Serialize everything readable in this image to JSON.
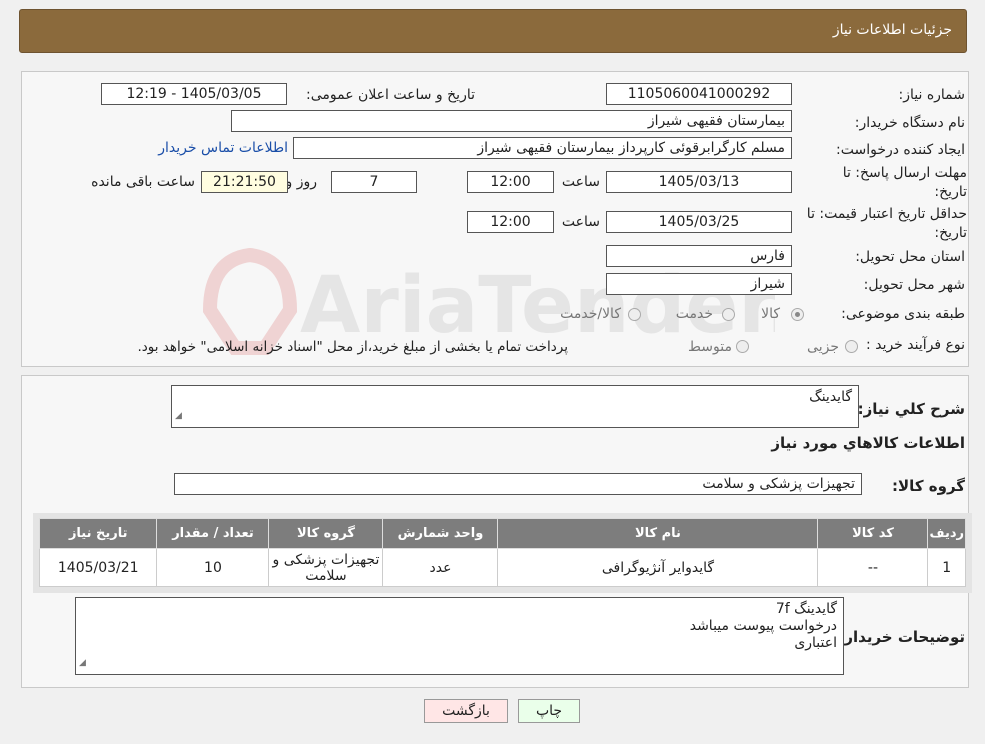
{
  "header": {
    "title": "جزئیات اطلاعات نیاز"
  },
  "form": {
    "need_number_label": "شماره نیاز:",
    "need_number": "1105060041000292",
    "announce_label": "تاریخ و ساعت اعلان عمومی:",
    "announce_value": "1405/03/05 - 12:19",
    "buyer_org_label": "نام دستگاه خریدار:",
    "buyer_org": "بیمارستان فقیهی شیراز",
    "creator_label": "ایجاد کننده درخواست:",
    "creator": "مسلم کارگرابرقوئی کارپرداز  بیمارستان فقیهی شیراز",
    "contact_link": "اطلاعات تماس خریدار",
    "deadline_label": "مهلت ارسال پاسخ: تا تاریخ:",
    "deadline_date": "1405/03/13",
    "time_label": "ساعت",
    "deadline_time": "12:00",
    "days_value": "7",
    "days_label": "روز و",
    "remaining_time": "21:21:50",
    "remaining_label": "ساعت باقی مانده",
    "validity_label": "حداقل تاریخ اعتبار قیمت: تا تاریخ:",
    "validity_date": "1405/03/25",
    "validity_time": "12:00",
    "province_label": "استان محل تحویل:",
    "province": "فارس",
    "city_label": "شهر محل تحویل:",
    "city": "شیراز",
    "category_label": "طبقه بندی موضوعی:",
    "category_options": [
      "کالا",
      "خدمت",
      "کالا/خدمت"
    ],
    "process_label": "نوع فرآیند خرید :",
    "process_options": [
      "جزیی",
      "متوسط"
    ],
    "process_note": "پرداخت تمام یا بخشی از مبلغ خرید،از محل \"اسناد خزانه اسلامی\" خواهد بود."
  },
  "summary": {
    "desc_label": "شرح کلي نياز:",
    "desc_value": "گایدینگ",
    "goods_info_title": "اطلاعات کالاهاي مورد نياز",
    "group_label": "گروه کالا:",
    "group_value": "تجهیزات پزشکی و سلامت"
  },
  "table": {
    "headers": [
      "رديف",
      "کد کالا",
      "نام کالا",
      "واحد شمارش",
      "گروه کالا",
      "تعداد / مقدار",
      "تاريخ نياز"
    ],
    "rows": [
      [
        "1",
        "--",
        "گایدوایر آنژیوگرافی",
        "عدد",
        "تجهیزات پزشکی و سلامت",
        "10",
        "1405/03/21"
      ]
    ]
  },
  "buyer_notes": {
    "label": "توضیحات خریدار:",
    "lines": [
      "گایدینگ 7f",
      "درخواست پیوست میباشد",
      "اعتباری"
    ]
  },
  "buttons": {
    "print": "چاپ",
    "back": "بازگشت"
  },
  "watermark": {
    "text": "AriaTender.neT"
  },
  "colors": {
    "header_bg": "#8b6a3c",
    "table_header_bg": "#7d7d7d",
    "print_bg": "#eaffea",
    "back_bg": "#ffe6e6",
    "link": "#1a4ea8"
  }
}
